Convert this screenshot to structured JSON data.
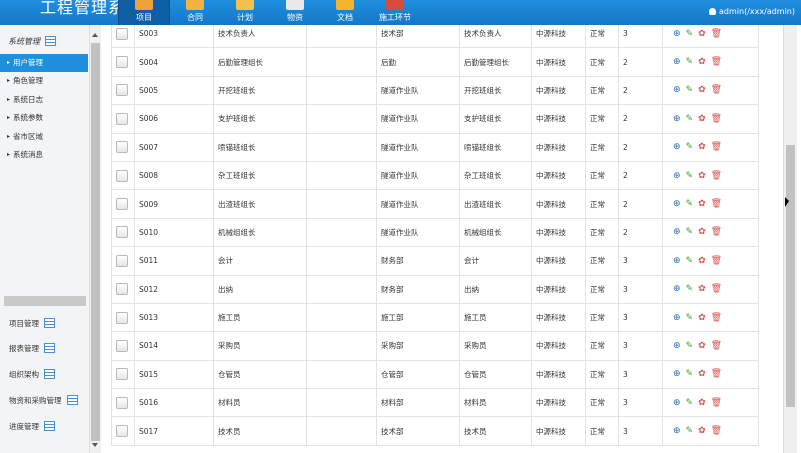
{
  "app": {
    "title": "工程管理系统",
    "user": "admin(/xxx/admin)"
  },
  "nav": [
    {
      "label": "项目",
      "icon": "project-folder-icon",
      "color": "#f0a33c",
      "active": true
    },
    {
      "label": "合同",
      "icon": "contract-tools-icon",
      "color": "#f2b441"
    },
    {
      "label": "计划",
      "icon": "plan-pencil-icon",
      "color": "#f4c04c"
    },
    {
      "label": "物资",
      "icon": "materials-printer-icon",
      "color": "#e8e8e8"
    },
    {
      "label": "文档",
      "icon": "document-envelope-icon",
      "color": "#f5b32e"
    },
    {
      "label": "施工环节",
      "icon": "construction-step-icon",
      "color": "#d94b3c"
    }
  ],
  "sidebar": {
    "heading": "系统管理",
    "items": [
      "用户管理",
      "角色管理",
      "系统日志",
      "系统参数",
      "省市区域",
      "系统消息"
    ],
    "groups": [
      "项目管理",
      "报表管理",
      "组织架构",
      "物资和采购管理",
      "进度管理"
    ]
  },
  "table": {
    "rows": [
      [
        "S003",
        "技术负责人",
        "技术部",
        "技术负责人",
        "中源科技",
        "正常",
        "3"
      ],
      [
        "S004",
        "后勤管理组长",
        "后勤",
        "后勤管理组长",
        "中源科技",
        "正常",
        "2"
      ],
      [
        "S005",
        "开挖班组长",
        "隧道作业队",
        "开挖班组长",
        "中源科技",
        "正常",
        "2"
      ],
      [
        "S006",
        "支护班组长",
        "隧道作业队",
        "支护班组长",
        "中源科技",
        "正常",
        "2"
      ],
      [
        "S007",
        "喷锚班组长",
        "隧道作业队",
        "喷锚班组长",
        "中源科技",
        "正常",
        "2"
      ],
      [
        "S008",
        "杂工班组长",
        "隧道作业队",
        "杂工班组长",
        "中源科技",
        "正常",
        "2"
      ],
      [
        "S009",
        "出渣班组长",
        "隧道作业队",
        "出渣班组长",
        "中源科技",
        "正常",
        "2"
      ],
      [
        "S010",
        "机械组组长",
        "隧道作业队",
        "机械组组长",
        "中源科技",
        "正常",
        "2"
      ],
      [
        "S011",
        "会计",
        "财务部",
        "会计",
        "中源科技",
        "正常",
        "3"
      ],
      [
        "S012",
        "出纳",
        "财务部",
        "出纳",
        "中源科技",
        "正常",
        "3"
      ],
      [
        "S013",
        "施工员",
        "施工部",
        "施工员",
        "中源科技",
        "正常",
        "3"
      ],
      [
        "S014",
        "采购员",
        "采购部",
        "采购员",
        "中源科技",
        "正常",
        "3"
      ],
      [
        "S015",
        "仓管员",
        "仓管部",
        "仓管员",
        "中源科技",
        "正常",
        "3"
      ],
      [
        "S016",
        "材料员",
        "材料部",
        "材料员",
        "中源科技",
        "正常",
        "3"
      ],
      [
        "S017",
        "技术员",
        "技术部",
        "技术员",
        "中源科技",
        "正常",
        "3"
      ]
    ],
    "action_icons": [
      "view-magnifier-icon",
      "edit-pencil-icon",
      "permission-gear-icon",
      "delete-trash-icon"
    ]
  }
}
